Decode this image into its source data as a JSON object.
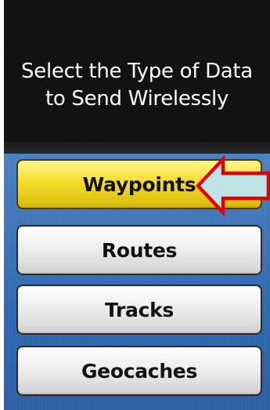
{
  "header": {
    "title": "Select the Type of Data\nto Send Wirelessly"
  },
  "options": [
    {
      "label": "Waypoints",
      "selected": true
    },
    {
      "label": "Routes",
      "selected": false
    },
    {
      "label": "Tracks",
      "selected": false
    },
    {
      "label": "Geocaches",
      "selected": false
    }
  ],
  "annotation": {
    "icon": "left-arrow-icon",
    "fill_color": "#bfe4e6",
    "stroke_color": "#e00000"
  },
  "colors": {
    "header_bg": "#101010",
    "list_bg": "#3069b0",
    "selected_button": "#f4de2a",
    "button": "#eeeeee"
  }
}
